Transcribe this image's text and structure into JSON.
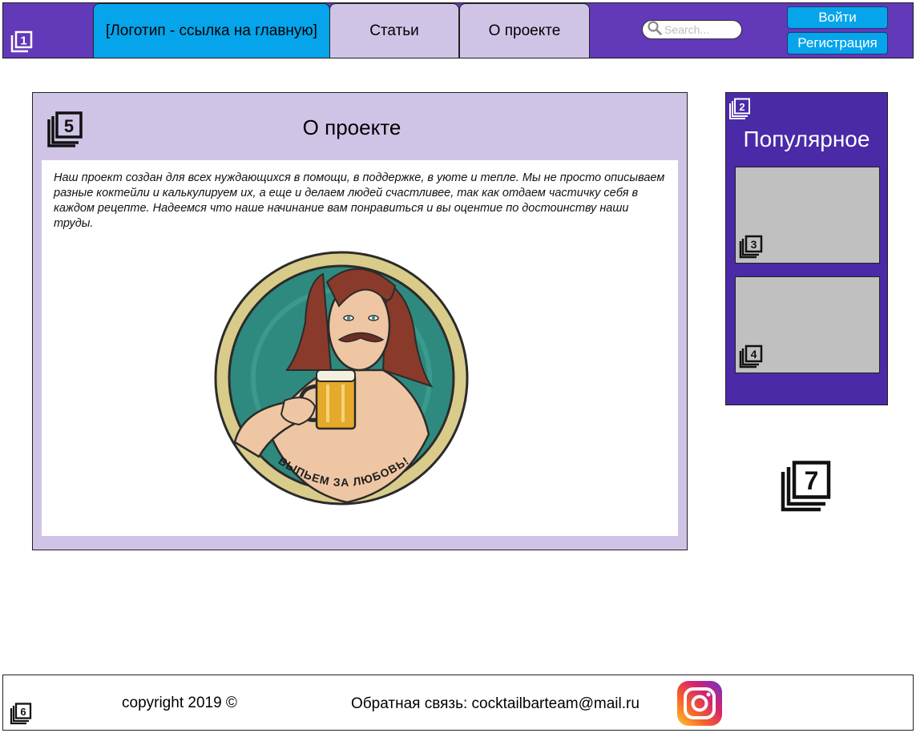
{
  "header": {
    "logo_tab": "[Логотип - ссылка на главную]",
    "tabs": [
      {
        "label": "Статьи"
      },
      {
        "label": "О проекте"
      }
    ],
    "search_placeholder": "Search...",
    "login_label": "Войти",
    "register_label": "Регистрация",
    "marker": "1"
  },
  "main": {
    "marker": "5",
    "title": "О проекте",
    "text": "Наш проект создан для всех нуждающихся в помощи, в поддержке, в уюте и тепле. Мы не просто описываем разные коктейли и калькулируем их, а еще и делаем людей счастливее, так как отдаем частичку себя в каждом рецепте. Надеемся что наше начинание вам понравиться и вы оцентие по достоинству наши труды.",
    "image_caption": "ВЫПЬЕМ ЗА ЛЮБОВЬ!"
  },
  "popular": {
    "marker": "2",
    "title": "Популярное",
    "cards": [
      {
        "marker": "3"
      },
      {
        "marker": "4"
      }
    ]
  },
  "side_marker": "7",
  "footer": {
    "marker": "6",
    "copyright": "copyright 2019 ©",
    "feedback": "Обратная связь: cocktailbarteam@mail.ru"
  },
  "colors": {
    "header_bg": "#6239b8",
    "logo_tab": "#06a4ea",
    "tab_bg": "#d0c4e6",
    "popular_bg": "#4a2aa6",
    "card_bg": "#c0c0c0"
  },
  "icons": [
    "search-icon",
    "numbered-placeholder-icon",
    "instagram-icon"
  ]
}
